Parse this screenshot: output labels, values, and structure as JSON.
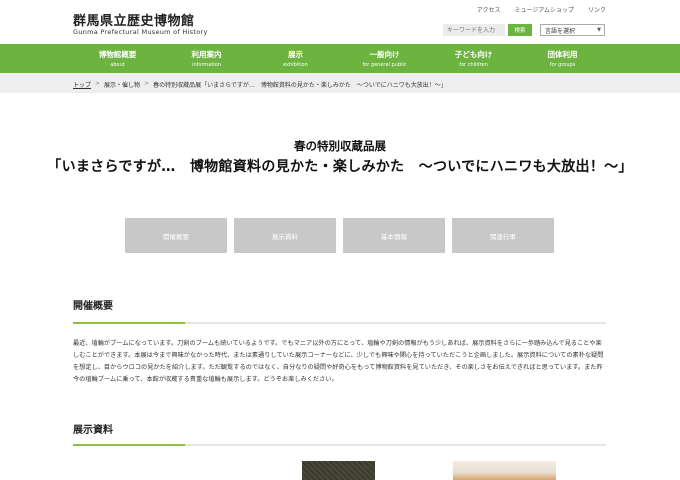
{
  "header": {
    "title": "群馬県立歴史博物館",
    "subtitle": "Gunma Prefectural Museum of History",
    "util_links": [
      "アクセス",
      "ミュージアムショップ",
      "リンク"
    ],
    "search_placeholder": "キーワードを入力",
    "search_button": "検索",
    "language_select": "言語を選択"
  },
  "nav": [
    {
      "ja": "博物館概要",
      "en": "about"
    },
    {
      "ja": "利用案内",
      "en": "information"
    },
    {
      "ja": "展示",
      "en": "exhibition"
    },
    {
      "ja": "一般向け",
      "en": "for general public"
    },
    {
      "ja": "子ども向け",
      "en": "for children"
    },
    {
      "ja": "団体利用",
      "en": "for groups"
    }
  ],
  "breadcrumb": {
    "home": "トップ",
    "level2": "展示・催し物",
    "current": "春の特別収蔵品展「いまさらですが…　博物館資料の見かた・楽しみかた　～ついでにハニワも大放出！～」"
  },
  "page": {
    "title_line1": "春の特別収蔵品展",
    "title_line2": "「いまさらですが…　博物館資料の見かた・楽しみかた　～ついでにハニワも大放出！～」"
  },
  "tabs": [
    "開催概要",
    "展示資料",
    "基本情報",
    "関連行事"
  ],
  "sections": {
    "overview_heading": "開催概要",
    "overview_text": "最近、埴輪がブームになっています。刀剣のブームも続いているようです。でもマニア以外の方にとって、埴輪や刀剣の情報がもう少しあれば、展示資料をさらに一歩踏み込んで見ることや楽しむことができます。本展は今まで興味がなかった時代、または素通りしていた展示コーナーなどに、少しでも興味や関心を持っていただこうと企画しました。展示資料についての素朴な疑問を想定し、目からウロコの見かたを紹介します。ただ観覧するのではなく、自分なりの疑問や好奇心をもって博物館資料を見ていただき、その楽しさをお伝えできればと思っています。また昨今の埴輪ブームに乗って、本館が収蔵する貴重な埴輪も展示します。どうぞお楽しみください。",
    "exhibits_heading": "展示資料"
  },
  "colors": {
    "brand_green": "#6cb33f",
    "accent_green": "#8dc33c",
    "tab_gray": "#c8c8c8",
    "crumb_bg": "#eeeeee"
  }
}
